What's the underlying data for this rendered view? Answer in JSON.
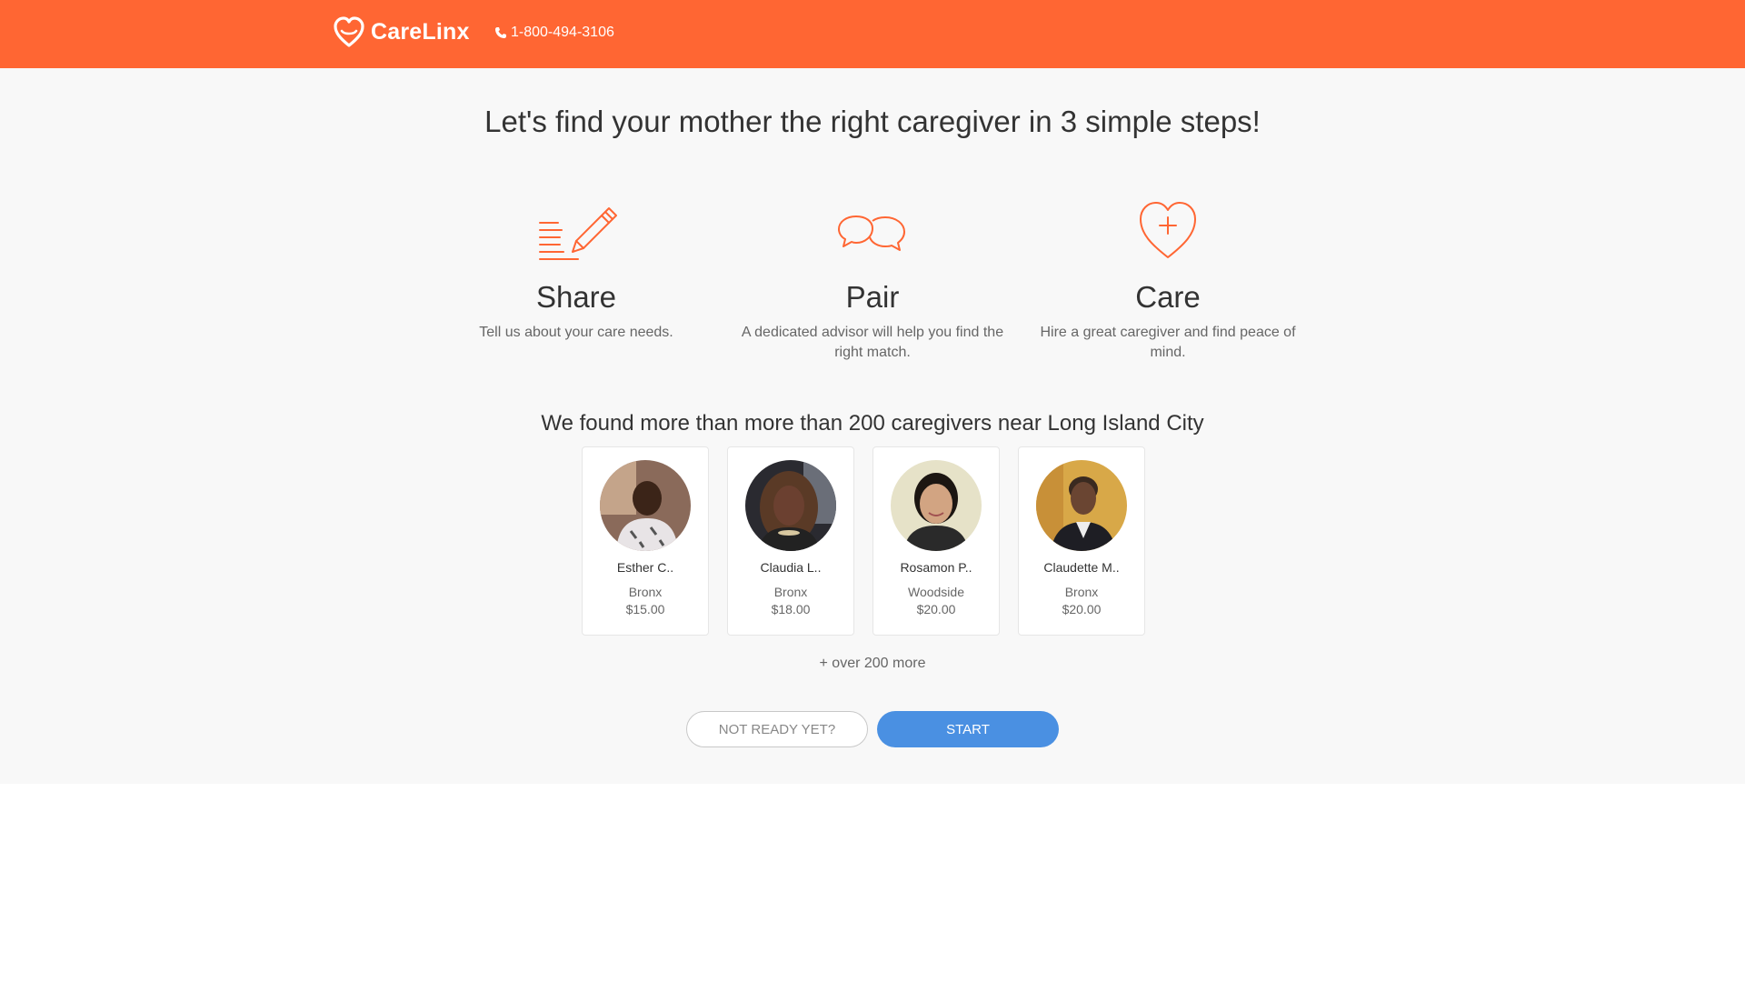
{
  "header": {
    "brand": "CareLinx",
    "phone": "1-800-494-3106",
    "logo_icon": "heart-logo-icon",
    "phone_icon": "phone-icon",
    "bg_color": "#ff6633"
  },
  "headline": "Let's find your mother the right caregiver in 3 simple steps!",
  "steps": [
    {
      "icon": "pencil-list-icon",
      "title": "Share",
      "description": "Tell us about your care needs."
    },
    {
      "icon": "chat-bubbles-icon",
      "title": "Pair",
      "description": "A dedicated advisor will help you find the right match."
    },
    {
      "icon": "heart-plus-icon",
      "title": "Care",
      "description": "Hire a great caregiver and find peace of mind."
    }
  ],
  "found_text": "We found more than more than 200 caregivers near Long Island City",
  "caregivers": [
    {
      "name": "Esther C..",
      "location": "Bronx",
      "rate": "$15.00"
    },
    {
      "name": "Claudia L..",
      "location": "Bronx",
      "rate": "$18.00"
    },
    {
      "name": "Rosamon P..",
      "location": "Woodside",
      "rate": "$20.00"
    },
    {
      "name": "Claudette M..",
      "location": "Bronx",
      "rate": "$20.00"
    }
  ],
  "more_text": "+ over 200 more",
  "buttons": {
    "not_ready": "NOT READY YET?",
    "start": "START"
  },
  "colors": {
    "accent": "#ff6633",
    "primary_button": "#4a90e2",
    "page_bg": "#f8f8f8"
  }
}
